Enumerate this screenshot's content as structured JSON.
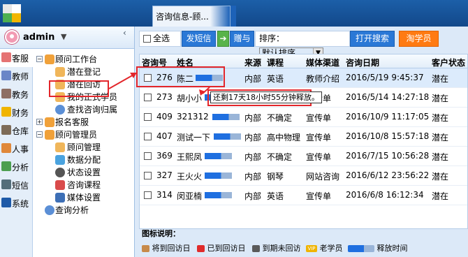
{
  "tabs": [
    {
      "label": "咨询信息-顾..."
    }
  ],
  "user": {
    "name": "admin",
    "caret": "▼"
  },
  "vertical_nav": [
    {
      "label": "客服",
      "active": true,
      "color": "#e57373"
    },
    {
      "label": "教师",
      "color": "#6a86c7"
    },
    {
      "label": "教务",
      "color": "#8d6e63"
    },
    {
      "label": "财务",
      "color": "#f0b400"
    },
    {
      "label": "仓库",
      "color": "#7d6b57"
    },
    {
      "label": "人事",
      "color": "#e0883a"
    },
    {
      "label": "分析",
      "color": "#4c9f50"
    },
    {
      "label": "短信",
      "color": "#546e7a"
    },
    {
      "label": "系统",
      "color": "#1e5aa8"
    }
  ],
  "tree": [
    {
      "label": "顾问工作台",
      "expander": "−",
      "level": 0
    },
    {
      "label": "潜在登记",
      "level": 1
    },
    {
      "label": "潜在回访",
      "level": 1
    },
    {
      "label": "我的正式学员",
      "level": 1
    },
    {
      "label": "查找咨询归属",
      "level": 1
    },
    {
      "label": "报名客服",
      "expander": "+",
      "level": 0
    },
    {
      "label": "顾问管理员",
      "expander": "−",
      "level": 0
    },
    {
      "label": "顾问管理",
      "level": 1
    },
    {
      "label": "数据分配",
      "level": 1
    },
    {
      "label": "状态设置",
      "level": 1
    },
    {
      "label": "咨询课程",
      "level": 1
    },
    {
      "label": "媒体设置",
      "level": 1
    },
    {
      "label": "查询分析",
      "level": 0
    }
  ],
  "toolbar": {
    "select_all": "全选",
    "send_sms": "发短信",
    "gift": "赠与",
    "sort_label": "排序：",
    "sort_value": "默认排序",
    "open_search": "打开搜索",
    "taoxueyuan": "淘学员"
  },
  "columns": [
    "咨询号",
    "姓名",
    "来源",
    "课程",
    "媒体渠道",
    "咨询日期",
    "客户状态"
  ],
  "rows": [
    {
      "id": "276",
      "name": "陈二",
      "source": "内部",
      "course": "英语",
      "channel": "教师介绍",
      "date": "2016/5/19 9:45:37",
      "status": "潜在",
      "selected": true
    },
    {
      "id": "273",
      "name": "胡小小",
      "source": "内部",
      "course": "",
      "channel": "宣传单",
      "date": "2016/5/14 14:27:18",
      "status": "潜在"
    },
    {
      "id": "409",
      "name": "321312",
      "source": "内部",
      "course": "不确定",
      "channel": "宣传单",
      "date": "2016/10/9 11:17:05",
      "status": "潜在"
    },
    {
      "id": "407",
      "name": "测试一下",
      "source": "内部",
      "course": "高中物理",
      "channel": "宣传单",
      "date": "2016/10/8 15:57:18",
      "status": "潜在"
    },
    {
      "id": "369",
      "name": "王熙凤",
      "source": "内部",
      "course": "不确定",
      "channel": "宣传单",
      "date": "2016/7/15 10:56:28",
      "status": "潜在"
    },
    {
      "id": "327",
      "name": "王火火",
      "source": "内部",
      "course": "钢琴",
      "channel": "网站咨询",
      "date": "2016/6/12 23:56:22",
      "status": "潜在"
    },
    {
      "id": "314",
      "name": "闵亚楠",
      "source": "内部",
      "course": "英语",
      "channel": "宣传单",
      "date": "2016/6/8 16:12:34",
      "status": "潜在"
    }
  ],
  "tooltip": "还剩17天18小时55分钟释放。",
  "legend": {
    "title": "图标说明：",
    "items": [
      "将到回访日",
      "已到回访日",
      "到期未回访",
      "老学员",
      "释放时间"
    ]
  }
}
